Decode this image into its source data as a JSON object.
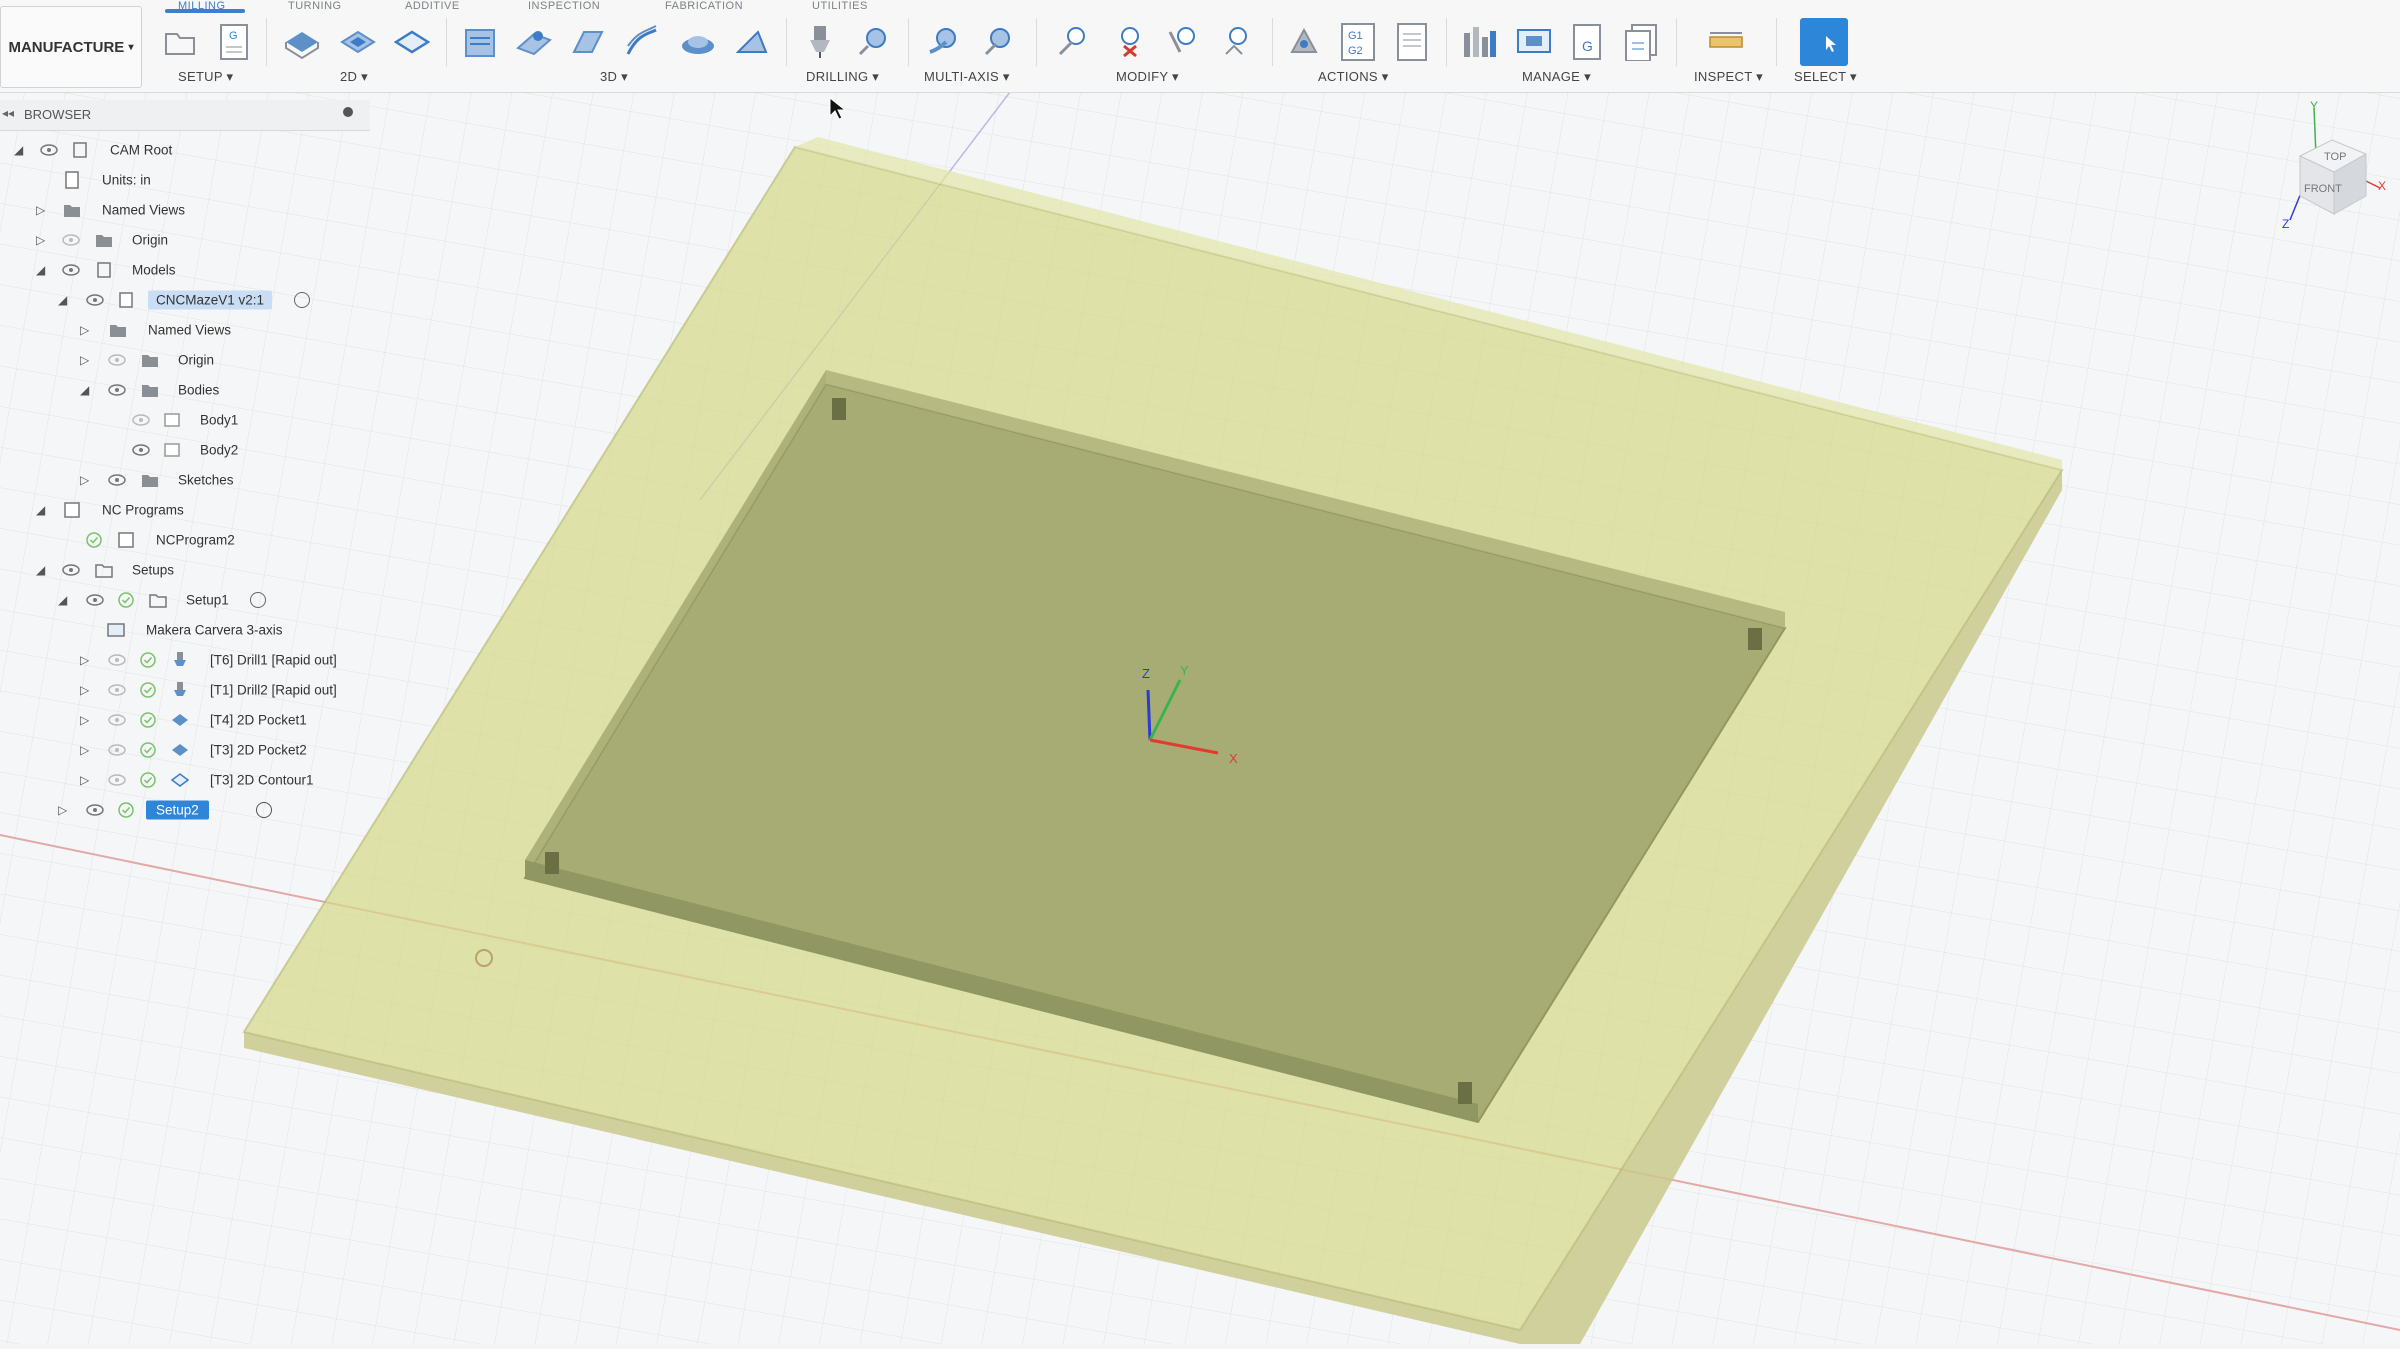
{
  "tabs": [
    "MILLING",
    "TURNING",
    "ADDITIVE",
    "INSPECTION",
    "FABRICATION",
    "UTILITIES"
  ],
  "workspace": "MANUFACTURE",
  "toolbar_groups": {
    "setup": "SETUP",
    "twod": "2D",
    "threed": "3D",
    "drilling": "DRILLING",
    "multiaxis": "MULTI-AXIS",
    "modify": "MODIFY",
    "actions": "ACTIONS",
    "manage": "MANAGE",
    "inspect": "INSPECT",
    "select": "SELECT"
  },
  "actions_icon_text": "G1\nG2",
  "browser": {
    "title": "BROWSER",
    "tree": [
      {
        "label": "CAM Root"
      },
      {
        "label": "Units: in"
      },
      {
        "label": "Named Views"
      },
      {
        "label": "Origin"
      },
      {
        "label": "Models"
      },
      {
        "label": "CNCMazeV1 v2:1"
      },
      {
        "label": "Named Views"
      },
      {
        "label": "Origin"
      },
      {
        "label": "Bodies"
      },
      {
        "label": "Body1"
      },
      {
        "label": "Body2"
      },
      {
        "label": "Sketches"
      },
      {
        "label": "NC Programs"
      },
      {
        "label": "NCProgram2"
      },
      {
        "label": "Setups"
      },
      {
        "label": "Setup1"
      },
      {
        "label": "Makera Carvera 3-axis"
      },
      {
        "label": "[T6] Drill1 [Rapid out]"
      },
      {
        "label": "[T1] Drill2 [Rapid out]"
      },
      {
        "label": "[T4] 2D Pocket1"
      },
      {
        "label": "[T3] 2D Pocket2"
      },
      {
        "label": "[T3] 2D Contour1"
      },
      {
        "label": "Setup2"
      }
    ]
  },
  "triad": {
    "z": "Z",
    "y": "Y",
    "x": "X"
  },
  "viewcube": {
    "top": "TOP",
    "front": "FRONT",
    "x": "X",
    "y": "Y",
    "z": "Z"
  },
  "colors": {
    "accent": "#2e86d8",
    "stock": "#d6d98a",
    "part": "#9da36a",
    "grid": "#dfe3e8"
  }
}
